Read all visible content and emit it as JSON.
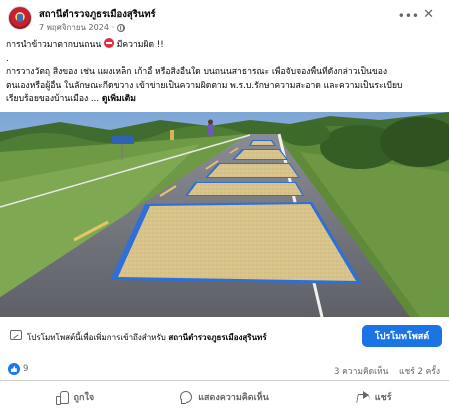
{
  "post": {
    "page_name": "สถานีตำรวจภูธรเมืองสุรินทร์",
    "date": "7 พฤศจิกายน 2024",
    "dot": "·",
    "more_icon": "ellipsis-icon",
    "close_icon": "close-icon",
    "headline": "การนำข้าวมาตากบนถนน",
    "headline_suffix": "มีความผิด !!",
    "separator_dot": ".",
    "body_line_1": "การวางวัตถุ สิ่งของ เช่น แผงเหล็ก เก้าอี้ หรือสิ่งอื่นใด บนถนนสาธารณะ เพื่อจับจองพื้นที่ดังกล่าวเป็นของ",
    "body_line_2": "ตนเองหรือผู้อื่น ในลักษณะกีดขวาง เข้าข่ายเป็นความผิดตาม พ.ร.บ.รักษาความสะอาด และความเป็นระเบียบ",
    "body_line_3": "เรียบร้อยของบ้านเมือง ...",
    "see_more": "ดูเพิ่มเติม"
  },
  "promote": {
    "text": "โปรโมทโพสต์นี้เพื่อเพิ่มการเข้าถึงสำหรับ",
    "page_name": "สถานีตำรวจภูธรเมืองสุรินทร์",
    "button_label": "โปรโมทโพสต์"
  },
  "stats": {
    "likes": "9",
    "comments": "3 ความคิดเห็น",
    "shares": "แชร์ 2 ครั้ง"
  },
  "actions": {
    "like": "ถูกใจ",
    "comment": "แสดงความคิดเห็น",
    "share": "แชร์"
  },
  "colors": {
    "accent": "#1b74e4",
    "like_blue": "#1877f2",
    "secondary_text": "#65676b",
    "tarp_blue": "#2f6fd6",
    "rice": "#d9c48c"
  }
}
